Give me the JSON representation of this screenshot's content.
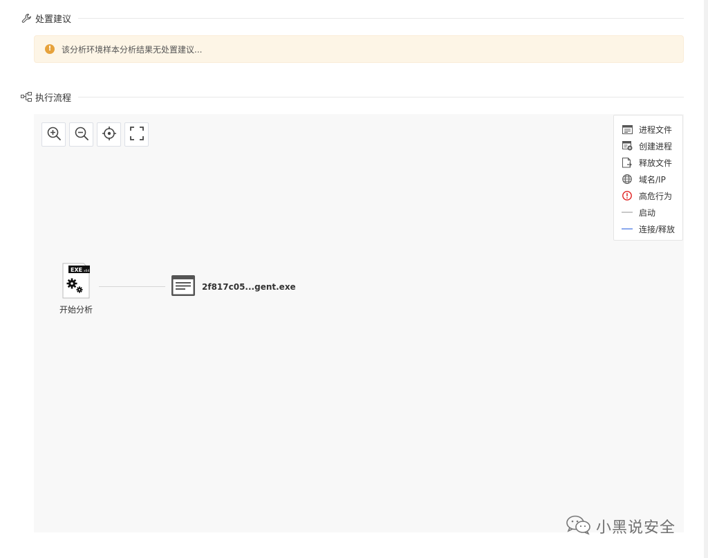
{
  "advice": {
    "title": "处置建议",
    "icon": "wrench-icon",
    "alert_text": "该分析环境样本分析结果无处置建议...",
    "alert_icon": "info-icon"
  },
  "flow": {
    "title": "执行流程",
    "icon": "flow-graph-icon",
    "toolbar": [
      {
        "name": "zoom-in",
        "icon": "zoom-in-icon"
      },
      {
        "name": "zoom-out",
        "icon": "zoom-out-icon"
      },
      {
        "name": "locate",
        "icon": "locate-icon"
      },
      {
        "name": "fullscreen",
        "icon": "fullscreen-icon"
      }
    ],
    "legend": [
      {
        "label": "进程文件",
        "icon": "process-file-icon"
      },
      {
        "label": "创建进程",
        "icon": "create-process-icon"
      },
      {
        "label": "释放文件",
        "icon": "release-file-icon"
      },
      {
        "label": "域名/IP",
        "icon": "globe-icon"
      },
      {
        "label": "高危行为",
        "icon": "alert-icon",
        "color": "#e02020"
      },
      {
        "label": "启动",
        "icon": "line-gray",
        "color": "#c8c8c8"
      },
      {
        "label": "连接/释放",
        "icon": "line-blue",
        "color": "#8aa8ee"
      }
    ],
    "nodes": {
      "start": {
        "label": "开始分析",
        "badge": "EXE",
        "badge_sub": "x64"
      },
      "process": {
        "label": "2f817c05...gent.exe"
      }
    }
  },
  "watermark": {
    "text": "小黑说安全",
    "icon": "wechat-icon"
  }
}
